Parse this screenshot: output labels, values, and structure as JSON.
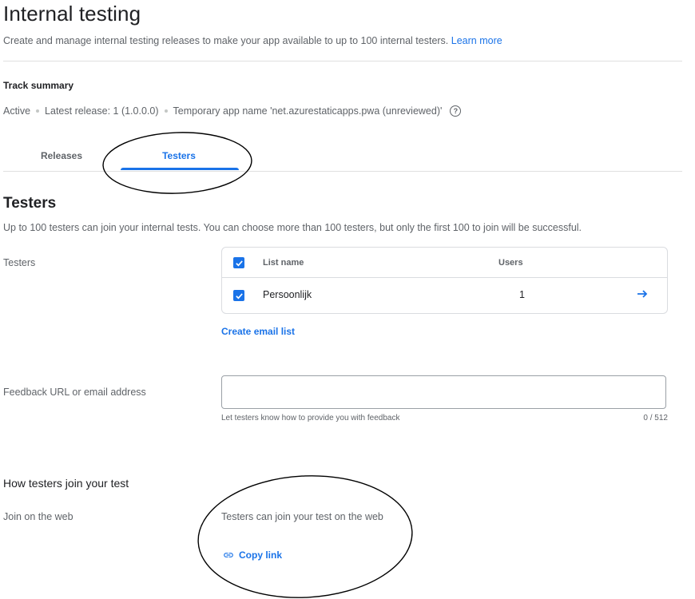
{
  "header": {
    "title": "Internal testing",
    "description": "Create and manage internal testing releases to make your app available to up to 100 internal testers.",
    "learn_more": "Learn more"
  },
  "track_summary": {
    "title": "Track summary",
    "status": "Active",
    "latest_release": "Latest release: 1 (1.0.0.0)",
    "temp_app_name": "Temporary app name 'net.azurestaticapps.pwa (unreviewed)'",
    "help_icon": "help-circle-icon"
  },
  "tabs": [
    {
      "label": "Releases",
      "selected": false
    },
    {
      "label": "Testers",
      "selected": true
    }
  ],
  "testers_section": {
    "title": "Testers",
    "description": "Up to 100 testers can join your internal tests. You can choose more than 100 testers, but only the first 100 to join will be successful.",
    "label": "Testers",
    "table": {
      "headers": {
        "list_name": "List name",
        "users": "Users"
      },
      "rows": [
        {
          "name": "Persoonlijk",
          "users": "1",
          "checked": true
        }
      ],
      "header_checked": true
    },
    "create_email_list": "Create email list"
  },
  "feedback": {
    "label": "Feedback URL or email address",
    "value": "",
    "hint": "Let testers know how to provide you with feedback",
    "counter": "0 / 512"
  },
  "join": {
    "title": "How testers join your test",
    "label": "Join on the web",
    "text": "Testers can join your test on the web",
    "copy_link": "Copy link",
    "copy_icon": "link-icon"
  },
  "colors": {
    "accent": "#1a73e8",
    "text": "#202124",
    "muted": "#5f6368",
    "divider": "#e0e0e0"
  }
}
